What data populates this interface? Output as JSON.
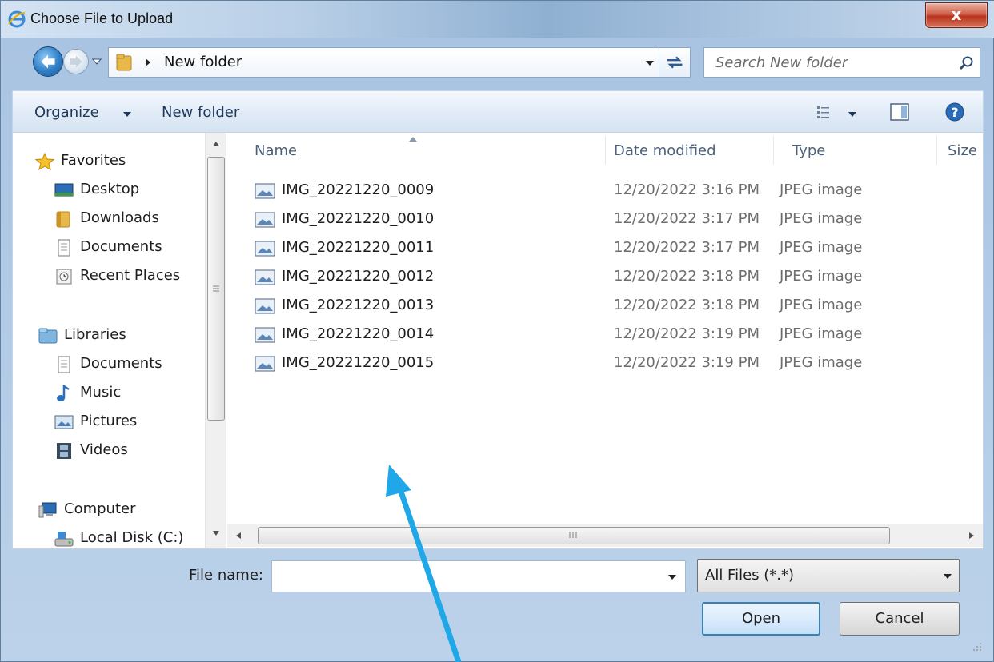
{
  "window": {
    "title": "Choose File to Upload",
    "close_label": "x"
  },
  "address": {
    "path_label": "New folder",
    "search_placeholder": "Search New folder"
  },
  "toolbar": {
    "organize_label": "Organize",
    "new_folder_label": "New folder"
  },
  "sidebar": {
    "favorites_header": "Favorites",
    "favorites": [
      "Desktop",
      "Downloads",
      "Documents",
      "Recent Places"
    ],
    "libraries_header": "Libraries",
    "libraries": [
      "Documents",
      "Music",
      "Pictures",
      "Videos"
    ],
    "computer_header": "Computer",
    "computer": [
      "Local Disk (C:)"
    ]
  },
  "columns": {
    "name": "Name",
    "date": "Date modified",
    "type": "Type",
    "size": "Size"
  },
  "files": [
    {
      "name": "IMG_20221220_0009",
      "date": "12/20/2022 3:16 PM",
      "type": "JPEG image"
    },
    {
      "name": "IMG_20221220_0010",
      "date": "12/20/2022 3:17 PM",
      "type": "JPEG image"
    },
    {
      "name": "IMG_20221220_0011",
      "date": "12/20/2022 3:17 PM",
      "type": "JPEG image"
    },
    {
      "name": "IMG_20221220_0012",
      "date": "12/20/2022 3:18 PM",
      "type": "JPEG image"
    },
    {
      "name": "IMG_20221220_0013",
      "date": "12/20/2022 3:18 PM",
      "type": "JPEG image"
    },
    {
      "name": "IMG_20221220_0014",
      "date": "12/20/2022 3:19 PM",
      "type": "JPEG image"
    },
    {
      "name": "IMG_20221220_0015",
      "date": "12/20/2022 3:19 PM",
      "type": "JPEG image"
    }
  ],
  "footer": {
    "filename_label": "File name:",
    "filename_value": "",
    "filter_label": "All Files (*.*)",
    "open_label": "Open",
    "cancel_label": "Cancel"
  },
  "colors": {
    "accent": "#3c7fb1",
    "annotation_arrow": "#1fa7e8"
  }
}
